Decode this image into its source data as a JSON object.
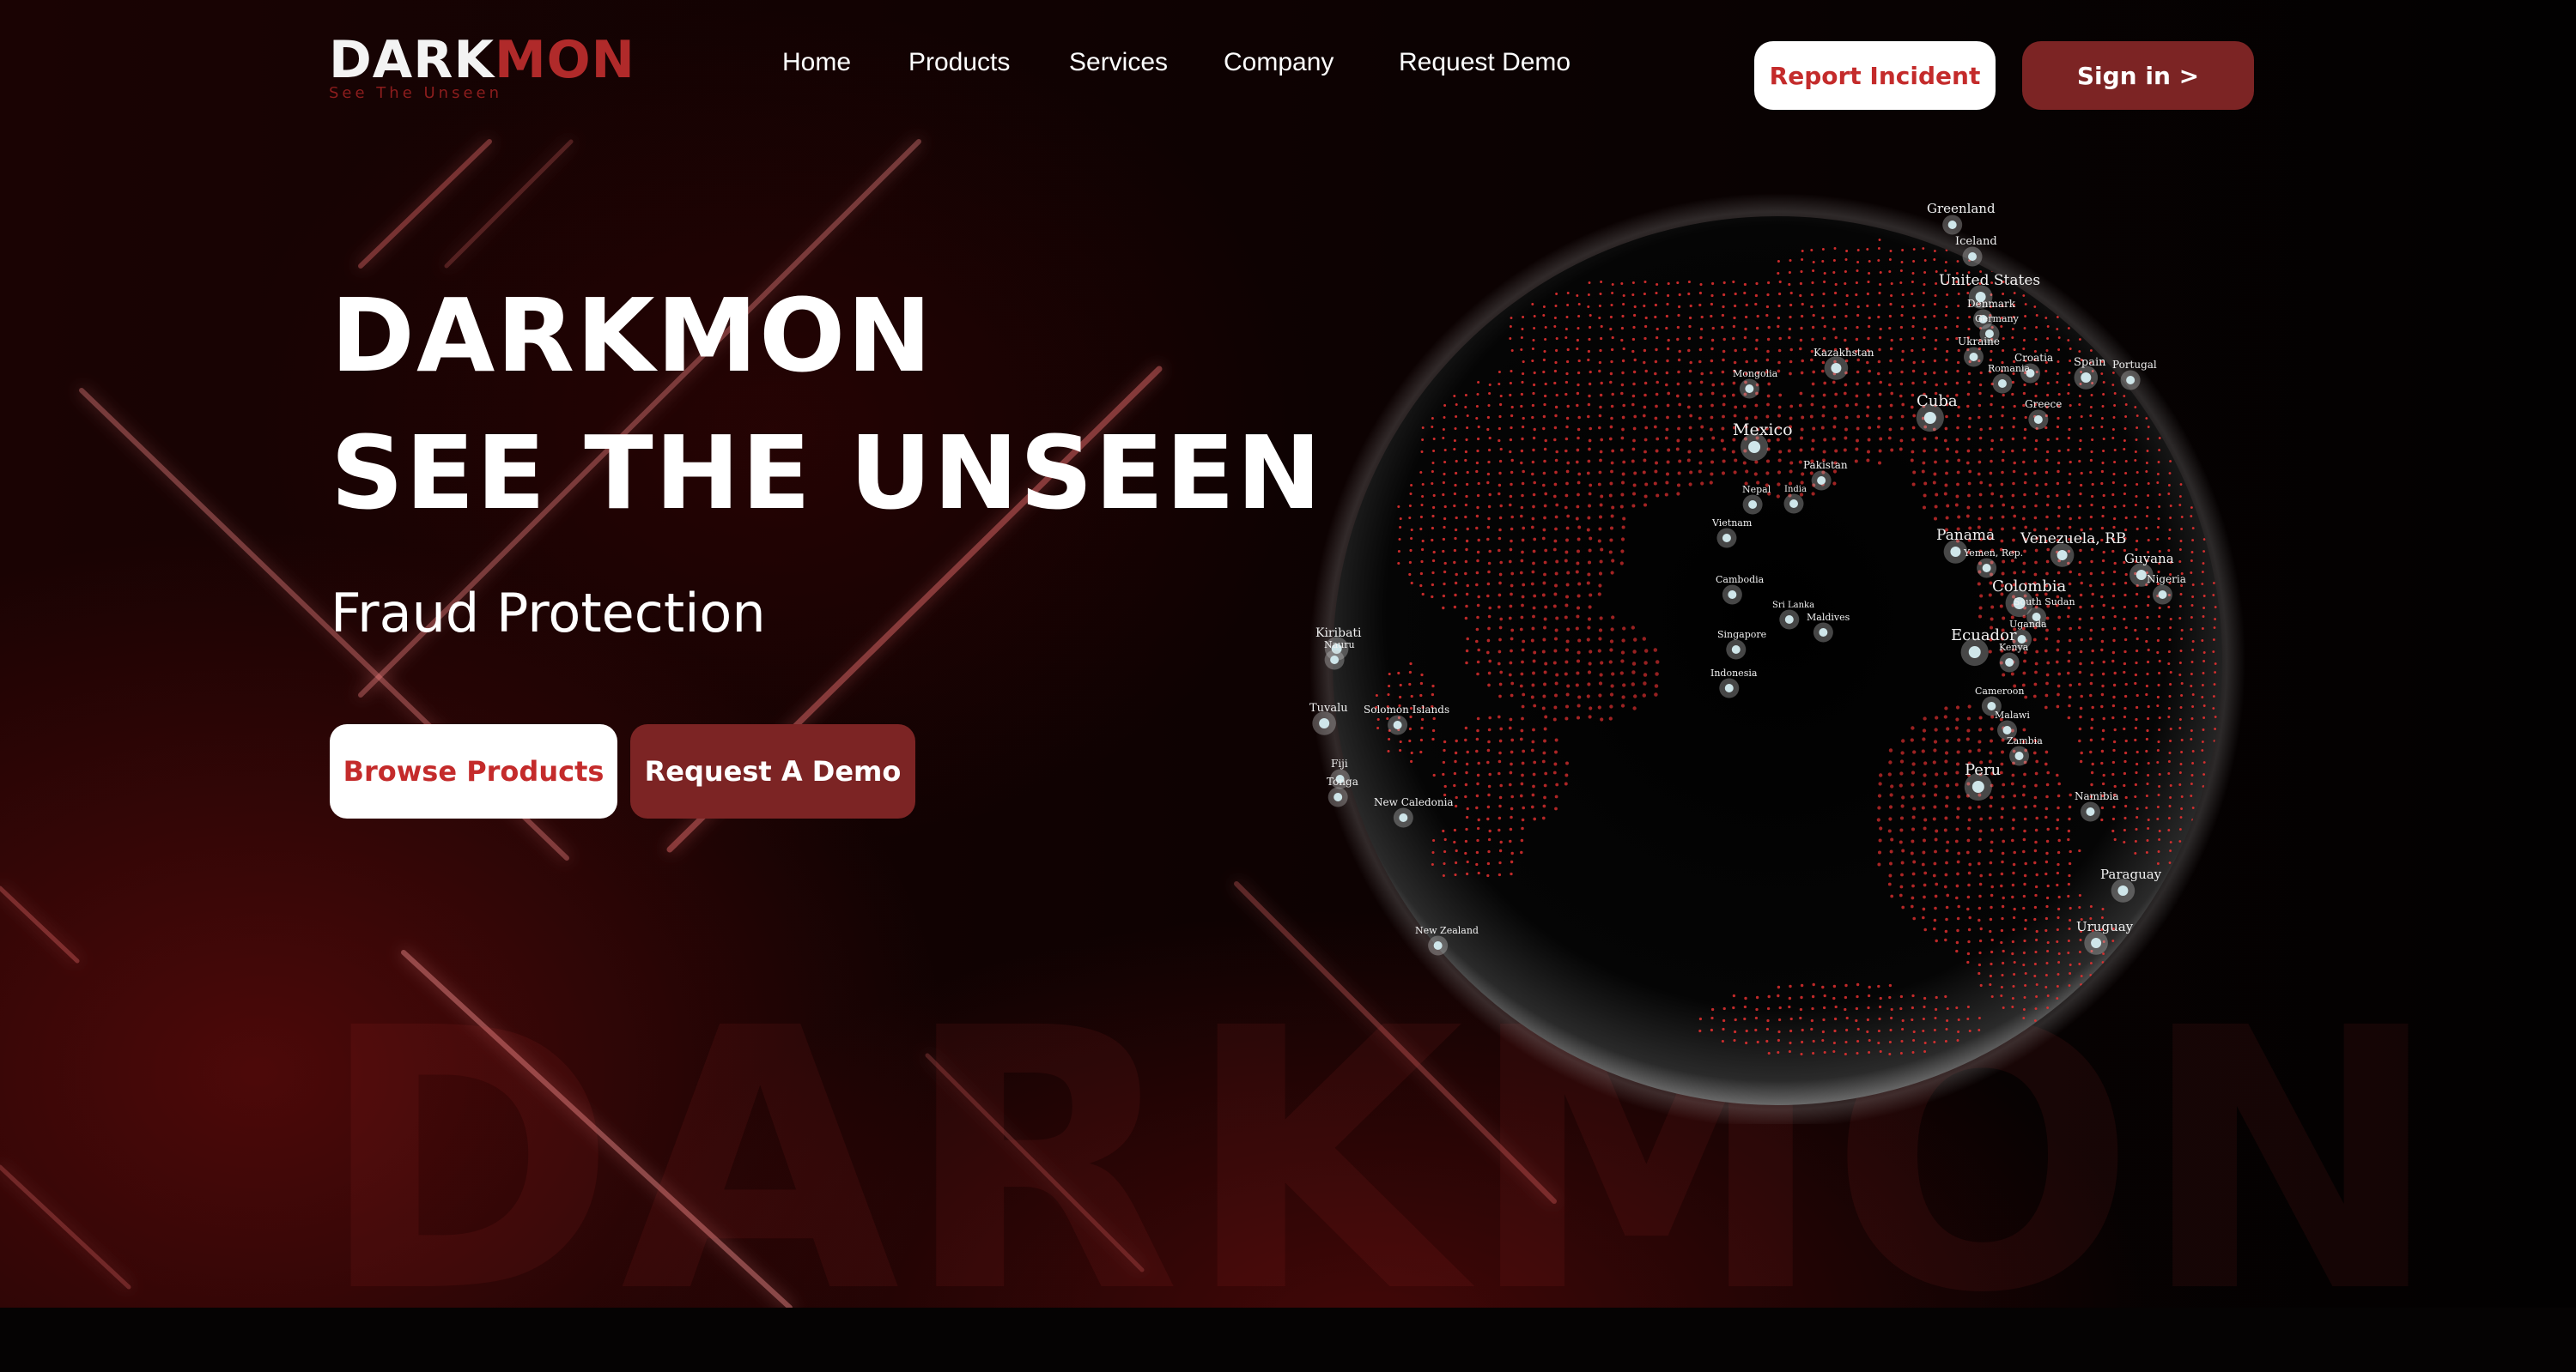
{
  "brand": {
    "logo_part1": "DARK",
    "logo_part2": "MON",
    "logo_tagline": "See The Unseen",
    "watermark": "DARKMON",
    "colors": {
      "accent_red": "#7c2424",
      "text_red": "#c42b2b",
      "globe_dot": "#e03030"
    }
  },
  "nav": {
    "links": [
      "Home",
      "Products",
      "Services",
      "Company",
      "Request Demo"
    ],
    "report_label": "Report Incident",
    "signin_label": "Sign in >"
  },
  "hero": {
    "title_line1": "DARKMON",
    "title_line2": "SEE THE UNSEEN",
    "subtitle": "Fraud Protection",
    "browse_label": "Browse Products",
    "demo_label": "Request A Demo"
  },
  "globe": {
    "labels": [
      "Greenland",
      "Iceland",
      "United States",
      "Denmark",
      "Germany",
      "Ukraine",
      "Croatia",
      "Romania",
      "Spain",
      "Portugal",
      "Greece",
      "Kazakhstan",
      "Mongolia",
      "Cuba",
      "Mexico",
      "Pakistan",
      "Nepal",
      "India",
      "Vietnam",
      "Cambodia",
      "Singapore",
      "Indonesia",
      "Sri Lanka",
      "Maldives",
      "Panama",
      "Yemen, Rep.",
      "Venezuela, RB",
      "Guyana",
      "Nigeria",
      "Colombia",
      "South Sudan",
      "Ecuador",
      "Uganda",
      "Kenya",
      "Cameroon",
      "Malawi",
      "Zambia",
      "Peru",
      "Namibia",
      "Paraguay",
      "Uruguay",
      "Kiribati",
      "Nauru",
      "Tuvalu",
      "Solomon Islands",
      "Fiji",
      "Tonga",
      "New Caledonia",
      "New Zealand"
    ]
  }
}
